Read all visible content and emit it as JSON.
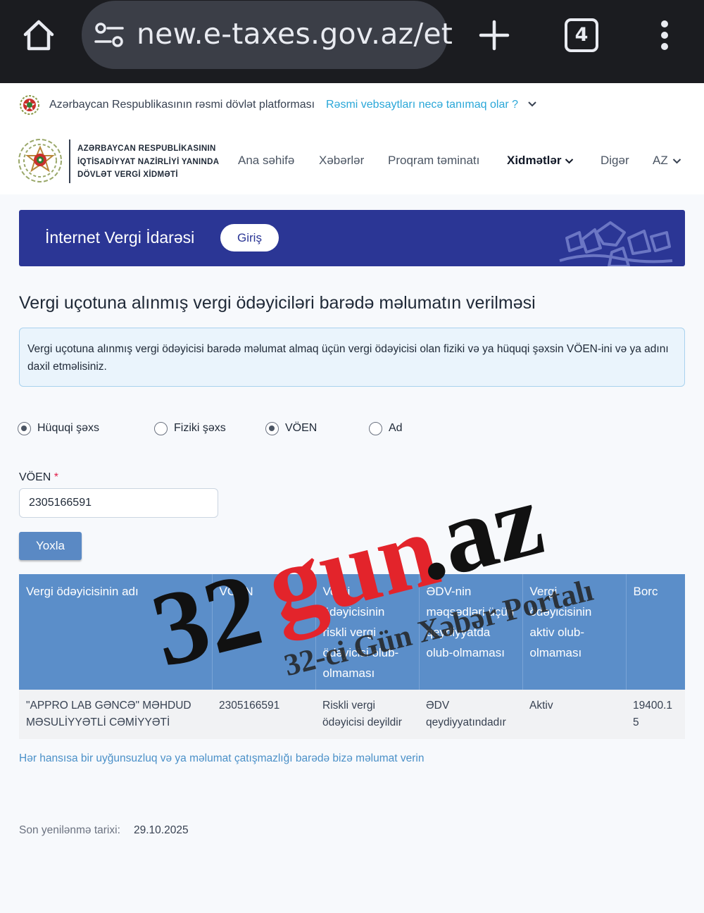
{
  "browser": {
    "url": "new.e-taxes.gov.az/et",
    "tab_count": "4",
    "icons": [
      "home-icon",
      "tune-icon",
      "plus-icon",
      "tabs-icon",
      "more-icon"
    ]
  },
  "official_bar": {
    "text": "Azərbaycan Respublikasının rəsmi dövlət platforması",
    "link": "Rəsmi vebsaytları necə tanımaq olar ?"
  },
  "header": {
    "org_line1": "AZƏRBAYCAN RESPUBLİKASININ",
    "org_line2": "İQTİSADİYYAT NAZİRLİYİ YANINDA",
    "org_line3": "DÖVLƏT VERGİ XİDMƏTİ",
    "nav": {
      "home": "Ana səhifə",
      "news": "Xəbərlər",
      "software": "Proqram təminatı",
      "services": "Xidmətlər",
      "other": "Digər",
      "lang": "AZ"
    }
  },
  "banner": {
    "title": "İnternet Vergi İdarəsi",
    "login": "Giriş",
    "color": "#2b3695"
  },
  "main": {
    "title": "Vergi uçotuna alınmış vergi ödəyiciləri barədə məlumatın verilməsi",
    "info": "Vergi uçotuna alınmış vergi ödəyicisi barədə məlumat almaq üçün vergi ödəyicisi olan fiziki və ya hüquqi şəxsin VÖEN-ini və ya adını daxil etməlisiniz."
  },
  "radios": {
    "legal": {
      "label": "Hüquqi şəxs",
      "checked": true
    },
    "physical": {
      "label": "Fiziki şəxs",
      "checked": false
    },
    "voen": {
      "label": "VÖEN",
      "checked": true
    },
    "name": {
      "label": "Ad",
      "checked": false
    }
  },
  "form": {
    "voen_label": "VÖEN",
    "required": "*",
    "voen_value": "2305166591",
    "check_button": "Yoxla"
  },
  "table": {
    "headers": {
      "name": "Vergi ödəyicisinin adı",
      "voen": "VÖEN",
      "risky": "Vergi ödəyicisinin riskli vergi ödəyicisi olub-olmaması",
      "vat": "ƏDV-nin məqsədləri üçün qeydiyyatda olub-olmaması",
      "active": "Vergi ödəyicisinin aktiv olub-olmaması",
      "debt": "Borc"
    },
    "rows": [
      {
        "name": "\"APPRO LAB GƏNCƏ\" MƏHDUD MƏSULİYYƏTLİ CƏMİYYƏTİ",
        "voen": "2305166591",
        "risky": "Riskli vergi ödəyicisi deyildir",
        "vat": "ƏDV qeydiyyatındadır",
        "active": "Aktiv",
        "debt": "19400.15"
      }
    ],
    "header_color": "#5b8ec9"
  },
  "footer": {
    "report_link": "Hər hansısa bir uyğunsuzluq və ya məlumat çatışmazlığı barədə bizə məlumat verin",
    "updated_label": "Son yenilənmə tarixi:",
    "updated_value": "29.10.2025"
  },
  "watermark": {
    "brand_num": "32",
    "brand_word": "gun",
    "brand_tld": ".az",
    "tagline": "32-ci Gün Xəbər Portalı"
  }
}
